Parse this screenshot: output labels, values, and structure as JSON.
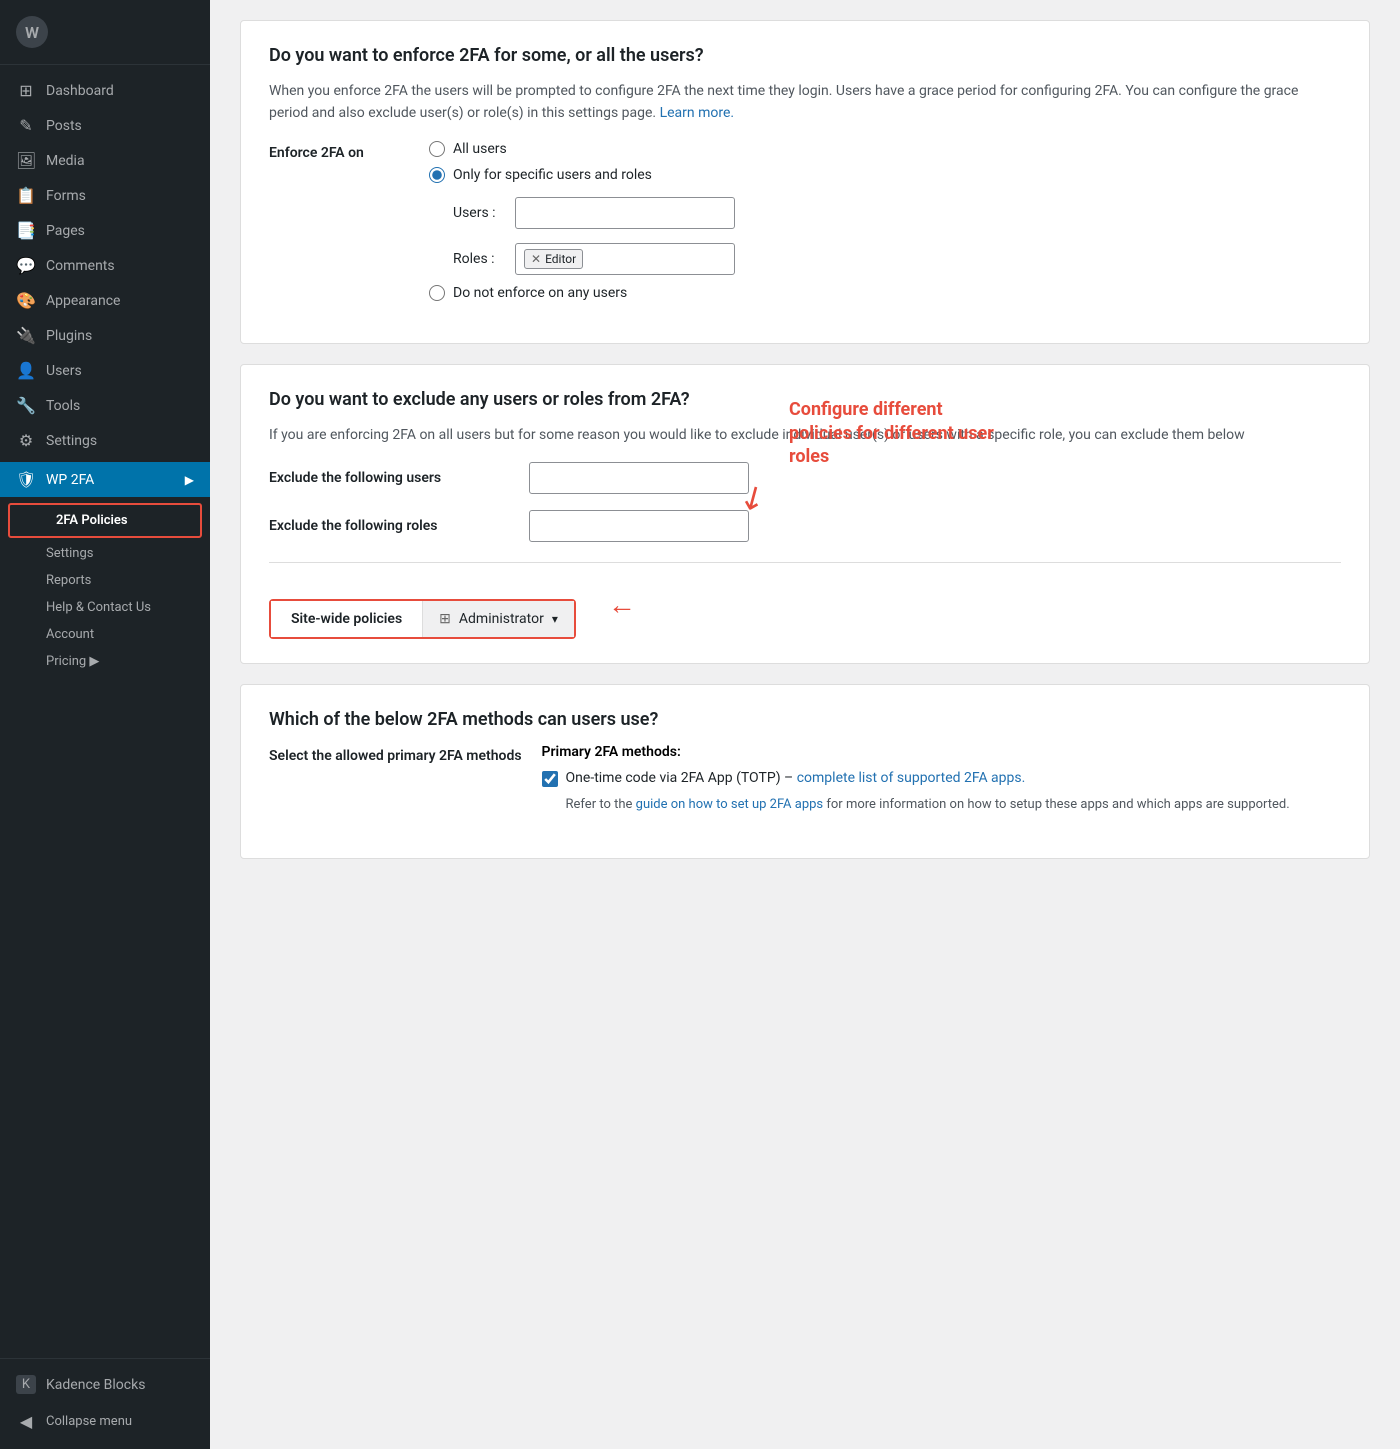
{
  "sidebar": {
    "logo": {
      "icon": "🏠",
      "title": ""
    },
    "items": [
      {
        "id": "dashboard",
        "label": "Dashboard",
        "icon": "⊞"
      },
      {
        "id": "posts",
        "label": "Posts",
        "icon": "📄"
      },
      {
        "id": "media",
        "label": "Media",
        "icon": "🖼"
      },
      {
        "id": "forms",
        "label": "Forms",
        "icon": "📋"
      },
      {
        "id": "pages",
        "label": "Pages",
        "icon": "📑"
      },
      {
        "id": "comments",
        "label": "Comments",
        "icon": "💬"
      },
      {
        "id": "appearance",
        "label": "Appearance",
        "icon": "🎨"
      },
      {
        "id": "plugins",
        "label": "Plugins",
        "icon": "🔌"
      },
      {
        "id": "users",
        "label": "Users",
        "icon": "👤"
      },
      {
        "id": "tools",
        "label": "Tools",
        "icon": "🔧"
      },
      {
        "id": "settings",
        "label": "Settings",
        "icon": "⚙"
      }
    ],
    "wp2fa": {
      "label": "WP 2FA",
      "icon": "🛡"
    },
    "submenu": [
      {
        "id": "2fa-policies",
        "label": "2FA Policies",
        "active": true
      },
      {
        "id": "settings",
        "label": "Settings"
      },
      {
        "id": "reports",
        "label": "Reports"
      },
      {
        "id": "help-contact",
        "label": "Help & Contact Us"
      },
      {
        "id": "account",
        "label": "Account"
      },
      {
        "id": "pricing",
        "label": "Pricing ▶"
      }
    ],
    "bottom": [
      {
        "id": "kadence-blocks",
        "label": "Kadence Blocks",
        "icon": "K"
      },
      {
        "id": "collapse",
        "label": "Collapse menu",
        "icon": "◀"
      }
    ]
  },
  "main": {
    "enforce_section": {
      "title": "Do you want to enforce 2FA for some, or all the users?",
      "description": "When you enforce 2FA the users will be prompted to configure 2FA the next time they login. Users have a grace period for configuring 2FA. You can configure the grace period and also exclude user(s) or role(s) in this settings page.",
      "learn_more": "Learn more.",
      "enforce_label": "Enforce 2FA on",
      "radio_options": [
        {
          "id": "all-users",
          "label": "All users",
          "checked": false
        },
        {
          "id": "specific-users",
          "label": "Only for specific users and roles",
          "checked": true
        },
        {
          "id": "no-users",
          "label": "Do not enforce on any users",
          "checked": false
        }
      ],
      "users_label": "Users :",
      "roles_label": "Roles :",
      "roles_tag": "Editor"
    },
    "exclude_section": {
      "title": "Do you want to exclude any users or roles from 2FA?",
      "description": "If you are enforcing 2FA on all users but for some reason you would like to exclude individual user(s) or users with a specific role, you can exclude them below",
      "exclude_users_label": "Exclude the following users",
      "exclude_roles_label": "Exclude the following roles"
    },
    "annotation": {
      "text": "Configure different policies for different user roles",
      "arrow": "↖"
    },
    "tabs": {
      "site_wide": "Site-wide policies",
      "administrator": "Administrator",
      "dropdown_icon": "⊞"
    },
    "methods_section": {
      "title": "Which of the below 2FA methods can users use?",
      "primary_label": "Select the allowed primary 2FA methods",
      "primary_methods_title": "Primary 2FA methods:",
      "checkbox_totp": "One-time code via 2FA App (TOTP) –",
      "totp_link": "complete list of supported 2FA apps.",
      "totp_guide_prefix": "Refer to the",
      "totp_guide_link": "guide on how to set up 2FA apps",
      "totp_guide_suffix": "for more information on how to setup these apps and which apps are supported."
    }
  }
}
